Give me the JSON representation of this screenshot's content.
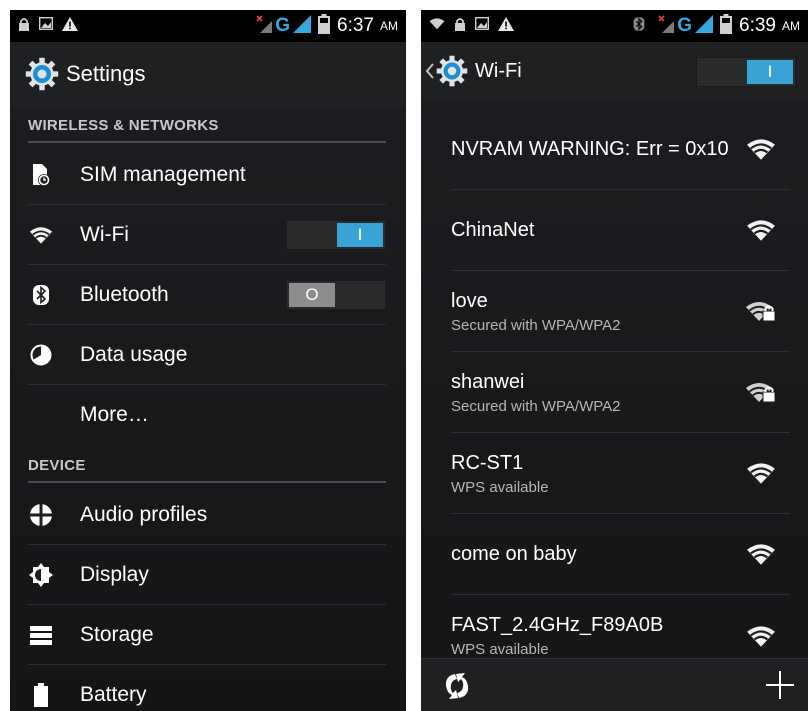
{
  "left_screen": {
    "status_bar": {
      "time": "6:37",
      "ampm": "AM",
      "network": "G"
    },
    "action_bar": {
      "title": "Settings",
      "icon": "settings-gear-icon"
    },
    "sections": [
      {
        "header": "WIRELESS & NETWORKS",
        "items": [
          {
            "label": "SIM management",
            "icon": "sim-icon"
          },
          {
            "label": "Wi-Fi",
            "icon": "wifi-icon",
            "toggle": "on",
            "toggle_text": "I"
          },
          {
            "label": "Bluetooth",
            "icon": "bluetooth-icon",
            "toggle": "off",
            "toggle_text": "O"
          },
          {
            "label": "Data usage",
            "icon": "data-usage-icon"
          },
          {
            "label": "More…"
          }
        ]
      },
      {
        "header": "DEVICE",
        "items": [
          {
            "label": "Audio profiles",
            "icon": "audio-profiles-icon"
          },
          {
            "label": "Display",
            "icon": "display-icon"
          },
          {
            "label": "Storage",
            "icon": "storage-icon"
          },
          {
            "label": "Battery",
            "icon": "battery-icon"
          }
        ]
      }
    ]
  },
  "right_screen": {
    "status_bar": {
      "time": "6:39",
      "ampm": "AM",
      "network": "G"
    },
    "action_bar": {
      "title": "Wi-Fi",
      "toggle": "on",
      "toggle_text": "I"
    },
    "networks": [
      {
        "ssid": "NVRAM WARNING: Err = 0x10",
        "sub": "",
        "secured": false
      },
      {
        "ssid": "ChinaNet",
        "sub": "",
        "secured": false
      },
      {
        "ssid": "love",
        "sub": "Secured with WPA/WPA2",
        "secured": true
      },
      {
        "ssid": "shanwei",
        "sub": "Secured with WPA/WPA2",
        "secured": true
      },
      {
        "ssid": "RC-ST1",
        "sub": "WPS available",
        "secured": false
      },
      {
        "ssid": "come on baby",
        "sub": "",
        "secured": false
      },
      {
        "ssid": "FAST_2.4GHz_F89A0B",
        "sub": "WPS available",
        "secured": false
      }
    ],
    "bottom_bar": {
      "left_icon": "wps-icon",
      "right_icon": "add-network-icon"
    }
  },
  "colors": {
    "accent": "#34a7dc",
    "toggle_on": "#3aa3d6",
    "toggle_off": "#8b8d8f"
  }
}
